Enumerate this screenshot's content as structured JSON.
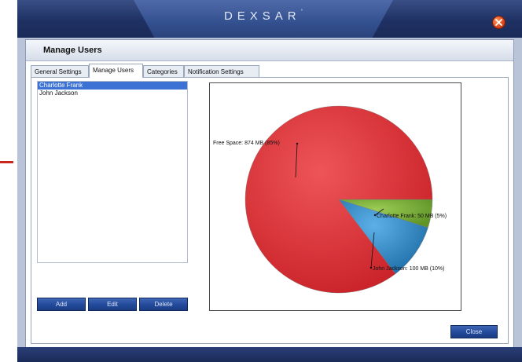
{
  "window": {
    "brand": "DEXSAR",
    "brand_mark": "°"
  },
  "section": {
    "title": "Manage Users"
  },
  "tabs": [
    {
      "label": "General Settings"
    },
    {
      "label": "Manage Users"
    },
    {
      "label": "Categories"
    },
    {
      "label": "Notification Settings"
    }
  ],
  "users": [
    {
      "name": "Charlotte Frank",
      "selected": true
    },
    {
      "name": "John Jackson",
      "selected": false
    }
  ],
  "buttons": {
    "add": "Add",
    "edit": "Edit",
    "delete": "Delete",
    "close": "Close"
  },
  "chart_data": {
    "type": "pie",
    "slices": [
      {
        "label": "Free Space: 874 MB (85%)",
        "value": 874,
        "color": "#e03a3e"
      },
      {
        "label": "Charlotte Frank: 50 MB (5%)",
        "value": 50,
        "color": "#7cb33a"
      },
      {
        "label": "John Jackson: 100 MB (10%)",
        "value": 100,
        "color": "#2f8bc9"
      }
    ]
  },
  "colors": {
    "accent": "#224a9b",
    "selection": "#3b72d4",
    "close_icon": "#e0461b"
  },
  "icons": {
    "window_close": "close-icon"
  }
}
